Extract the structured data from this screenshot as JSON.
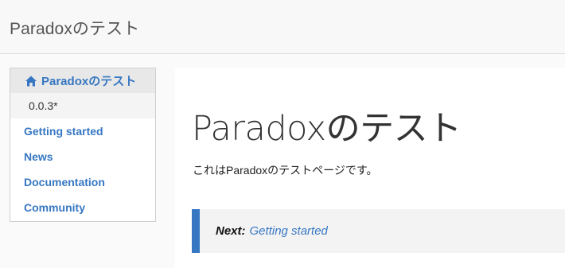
{
  "header": {
    "brand": "Paradoxのテスト"
  },
  "sidebar": {
    "home_label": "Paradoxのテスト",
    "version": "0.0.3*",
    "items": [
      {
        "label": "Getting started"
      },
      {
        "label": "News"
      },
      {
        "label": "Documentation"
      },
      {
        "label": "Community"
      }
    ]
  },
  "main": {
    "title": "Paradoxのテスト",
    "intro": "これはParadoxのテストページです。",
    "next_label": "Next:",
    "next_link": "Getting started"
  },
  "colors": {
    "accent": "#3777c2",
    "topbar_bg": "#f8f8f8",
    "callout_bg": "#f3f3f3"
  },
  "icons": {
    "home": "home-icon"
  }
}
